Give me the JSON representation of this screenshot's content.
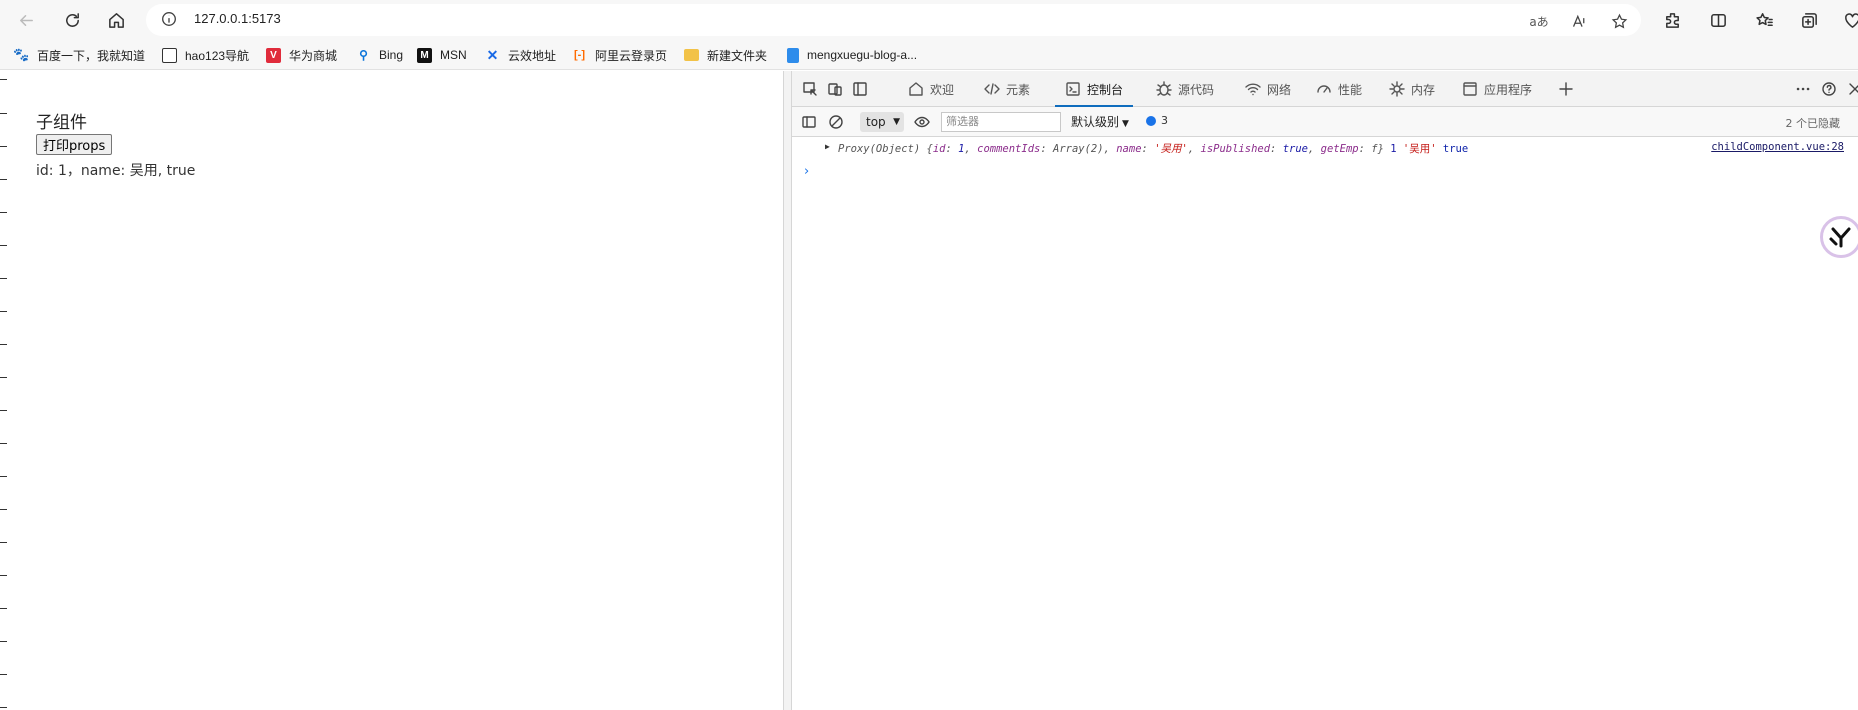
{
  "browser": {
    "url": "127.0.0.1:5173",
    "read_aloud_icon": "read-aloud-icon",
    "bookmarks": [
      {
        "label": "百度一下，我就知道",
        "color": "#2932e1"
      },
      {
        "label": "hao123导航",
        "color": "#ffffff"
      },
      {
        "label": "华为商城",
        "color": "#e02b3b"
      },
      {
        "label": "Bing",
        "color": "#0a74da"
      },
      {
        "label": "MSN",
        "color": "#111111"
      },
      {
        "label": "云效地址",
        "color": "#1a6ae6"
      },
      {
        "label": "阿里云登录页",
        "color": "#ff6a00"
      },
      {
        "label": "新建文件夹",
        "color": "#f2c247"
      },
      {
        "label": "mengxuegu-blog-a...",
        "color": "#2e8ceb"
      }
    ]
  },
  "page": {
    "heading": "子组件",
    "button_label": "打印props",
    "output": "id: 1，name: 吴用, true"
  },
  "devtools": {
    "tabs": [
      {
        "label": "欢迎"
      },
      {
        "label": "元素"
      },
      {
        "label": "控制台"
      },
      {
        "label": "源代码"
      },
      {
        "label": "网络"
      },
      {
        "label": "性能"
      },
      {
        "label": "内存"
      },
      {
        "label": "应用程序"
      }
    ],
    "active_tab": "控制台",
    "context": "top",
    "filter_placeholder": "筛选器",
    "levels": "默认级别",
    "message_count": "3",
    "hidden_count": "2 个已隐藏",
    "log": {
      "prefix": "Proxy(Object) {",
      "k_id": "id",
      "v_id": "1",
      "k_comments": "commentIds",
      "v_comments": "Array(2)",
      "k_name": "name",
      "v_name": "'吴用'",
      "k_pub": "isPublished",
      "v_pub": "true",
      "k_emp": "getEmp",
      "v_emp": "f",
      "suffix": "}",
      "arg_num": "1",
      "arg_str": "'吴用'",
      "arg_bool": "true",
      "source": "childComponent.vue:28"
    },
    "accent": "#0f6cbd"
  }
}
